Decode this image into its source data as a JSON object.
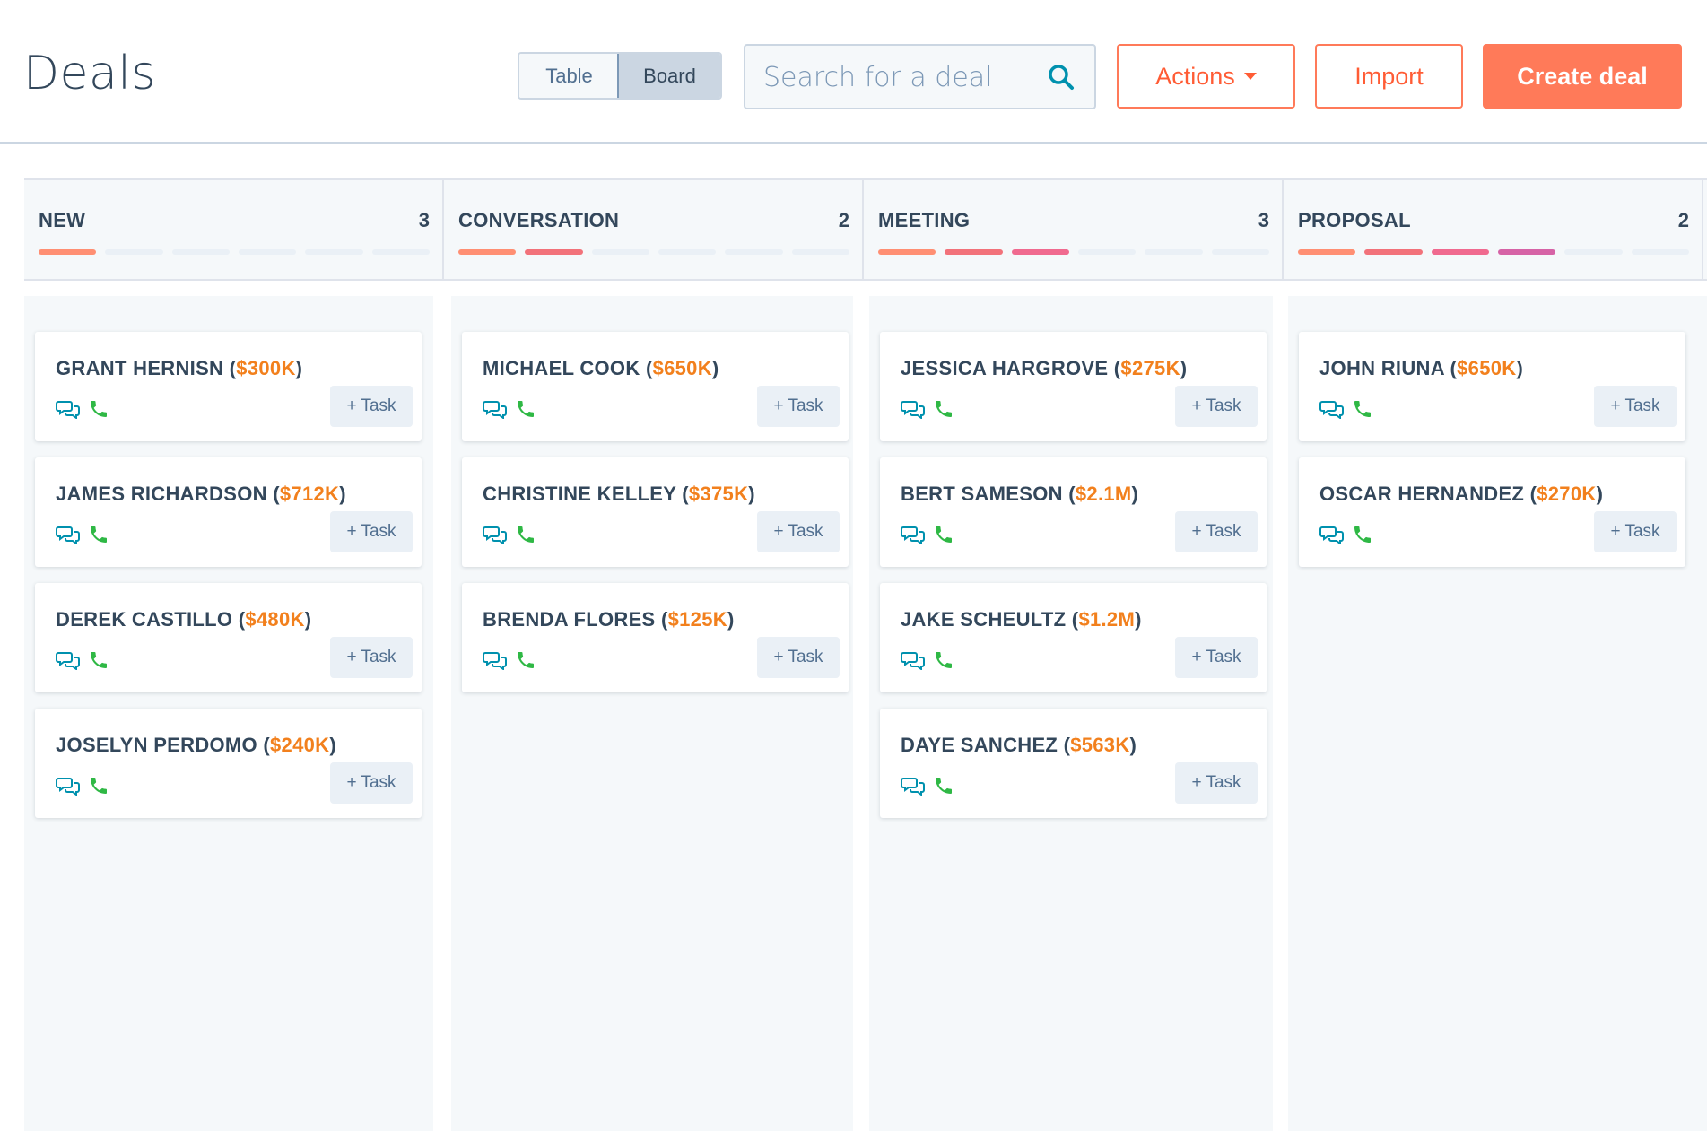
{
  "header": {
    "title": "Deals",
    "view_toggle": {
      "table_label": "Table",
      "board_label": "Board",
      "selected": "Board"
    },
    "search": {
      "placeholder": "Search for a deal"
    },
    "actions_label": "Actions",
    "import_label": "Import",
    "create_label": "Create deal"
  },
  "colors": {
    "accent": "#ff7a59",
    "amount": "#f2801d",
    "chat_icon": "#0091ae",
    "phone_icon": "#2fb845",
    "text": "#33475b"
  },
  "stages": [
    {
      "name": "NEW",
      "count": "3",
      "progress_colors": [
        "#ff8f73"
      ]
    },
    {
      "name": "CONVERSATION",
      "count": "2",
      "progress_colors": [
        "#ff8f73",
        "#f2727a"
      ]
    },
    {
      "name": "MEETING",
      "count": "3",
      "progress_colors": [
        "#ff8f73",
        "#f2727a",
        "#f06a8f"
      ]
    },
    {
      "name": "PROPOSAL",
      "count": "2",
      "progress_colors": [
        "#ff8f73",
        "#f2727a",
        "#f06a8f",
        "#d663a6"
      ]
    }
  ],
  "columns": [
    {
      "cards": [
        {
          "name": "GRANT HERNISN",
          "amount": "$300K",
          "task_label": "+ Task"
        },
        {
          "name": "JAMES RICHARDSON",
          "amount": "$712K",
          "task_label": "+ Task"
        },
        {
          "name": "DEREK CASTILLO",
          "amount": "$480K",
          "task_label": "+ Task"
        },
        {
          "name": "JOSELYN PERDOMO",
          "amount": "$240K",
          "task_label": "+ Task"
        }
      ]
    },
    {
      "cards": [
        {
          "name": "MICHAEL COOK",
          "amount": "$650K",
          "task_label": "+ Task"
        },
        {
          "name": "CHRISTINE KELLEY",
          "amount": "$375K",
          "task_label": "+ Task"
        },
        {
          "name": "BRENDA FLORES",
          "amount": "$125K",
          "task_label": "+ Task"
        }
      ]
    },
    {
      "cards": [
        {
          "name": "JESSICA HARGROVE",
          "amount": "$275K",
          "task_label": "+ Task"
        },
        {
          "name": "BERT SAMESON",
          "amount": "$2.1M",
          "task_label": "+ Task"
        },
        {
          "name": "JAKE SCHEULTZ",
          "amount": "$1.2M",
          "task_label": "+ Task"
        },
        {
          "name": "DAYE SANCHEZ",
          "amount": "$563K",
          "task_label": "+ Task"
        }
      ]
    },
    {
      "cards": [
        {
          "name": "JOHN RIUNA",
          "amount": "$650K",
          "task_label": "+ Task"
        },
        {
          "name": "OSCAR HERNANDEZ",
          "amount": "$270K",
          "task_label": "+ Task"
        }
      ]
    }
  ],
  "icons": {
    "search": "search-icon",
    "caret": "caret-down-icon",
    "chat": "chat-bubbles-icon",
    "phone": "phone-icon"
  }
}
